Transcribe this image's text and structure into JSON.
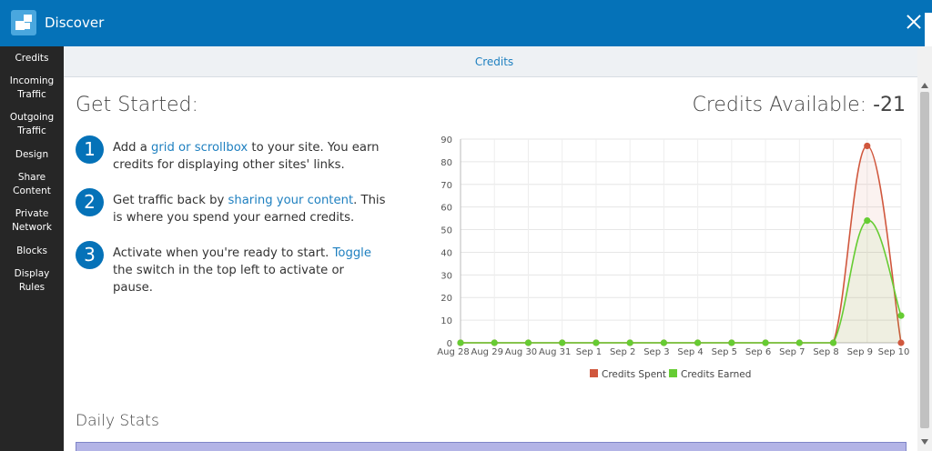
{
  "window": {
    "title": "Discover"
  },
  "sidebar": {
    "items": [
      {
        "label": "Credits"
      },
      {
        "label": "Incoming Traffic"
      },
      {
        "label": "Outgoing Traffic"
      },
      {
        "label": "Design"
      },
      {
        "label": "Share Content"
      },
      {
        "label": "Private Network"
      },
      {
        "label": "Blocks"
      },
      {
        "label": "Display Rules"
      }
    ]
  },
  "tabs": {
    "credits": "Credits"
  },
  "header": {
    "get_started": "Get Started:",
    "credits_label": "Credits Available:",
    "credits_value": "-21"
  },
  "steps": [
    {
      "num": "1",
      "pre": "Add a ",
      "link": "grid or scrollbox",
      "post": " to your site. You earn credits for displaying other sites' links."
    },
    {
      "num": "2",
      "pre": "Get traffic back by ",
      "link": "sharing your content",
      "post": ". This is where you spend your earned credits."
    },
    {
      "num": "3",
      "pre": "Activate when you're ready to start. ",
      "link": "Toggle",
      "post": " the switch in the top left to activate or pause."
    }
  ],
  "daily": {
    "title": "Daily Stats"
  },
  "chart_data": {
    "type": "area",
    "categories": [
      "Aug 28",
      "Aug 29",
      "Aug 30",
      "Aug 31",
      "Sep 1",
      "Sep 2",
      "Sep 3",
      "Sep 4",
      "Sep 5",
      "Sep 6",
      "Sep 7",
      "Sep 8",
      "Sep 9",
      "Sep 10"
    ],
    "series": [
      {
        "name": "Credits Spent",
        "color": "#d0573d",
        "values": [
          0,
          0,
          0,
          0,
          0,
          0,
          0,
          0,
          0,
          0,
          0,
          0,
          87,
          0
        ]
      },
      {
        "name": "Credits Earned",
        "color": "#66cc33",
        "values": [
          0,
          0,
          0,
          0,
          0,
          0,
          0,
          0,
          0,
          0,
          0,
          0,
          54,
          12
        ]
      }
    ],
    "ylim": [
      0,
      90
    ],
    "yticks": [
      0,
      10,
      20,
      30,
      40,
      50,
      60,
      70,
      80,
      90
    ],
    "grid": true,
    "legend": "bottom"
  }
}
